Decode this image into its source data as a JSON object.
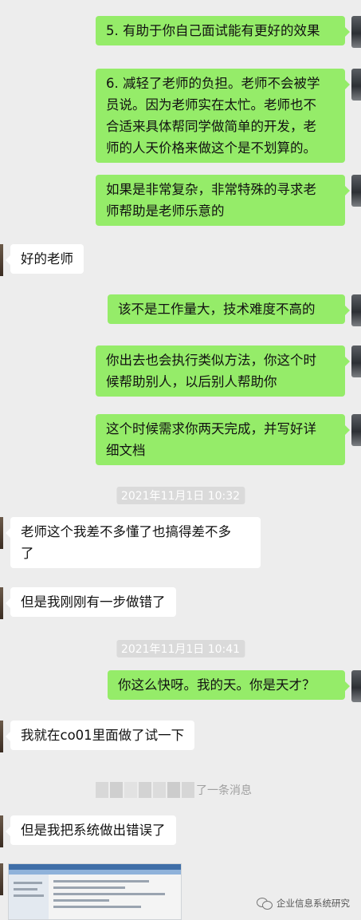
{
  "messages": [
    {
      "side": "out",
      "text": "5. 有助于你自己面试能有更好的效果"
    },
    {
      "side": "out",
      "text": "6. 减轻了老师的负担。老师不会被学\n员说。因为老师实在太忙。老师也不\n合适来具体帮同学做简单的开发，老\n师的人天价格来做这个是不划算的。"
    },
    {
      "side": "out",
      "text": "如果是非常复杂，非常特殊的寻求老\n师帮助是老师乐意的"
    },
    {
      "side": "in",
      "text": "好的老师"
    },
    {
      "side": "out",
      "text": "该不是工作量大，技术难度不高的"
    },
    {
      "side": "out",
      "text": "你出去也会执行类似方法，你这个时\n候帮助别人，以后别人帮助你"
    },
    {
      "side": "out",
      "text": "这个时候需求你两天完成，并写好详\n细文档"
    },
    {
      "side": "in",
      "text": "老师这个我差不多懂了也搞得差不多\n了"
    },
    {
      "side": "in",
      "text": "但是我刚刚有一步做错了"
    },
    {
      "side": "out",
      "text": "你这么快呀。我的天。你是天才？"
    },
    {
      "side": "in",
      "text": "我就在co01里面做了试一下"
    },
    {
      "side": "in",
      "text": "但是我把系统做出错误了"
    }
  ],
  "timestamps": [
    "2021年11月1日 10:32",
    "2021年11月1日 10:41"
  ],
  "system_message": "了一条消息",
  "watermark": "企业信息系统研究",
  "colors": {
    "background": "#ededed",
    "outgoing_bubble": "#95ec69",
    "incoming_bubble": "#ffffff",
    "timestamp_bg": "#dadada"
  }
}
